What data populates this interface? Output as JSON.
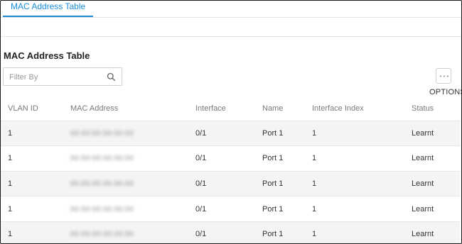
{
  "tabs": [
    {
      "label": "MAC Address Table",
      "active": true
    }
  ],
  "section": {
    "title": "MAC Address Table"
  },
  "filter": {
    "placeholder": "Filter By",
    "value": ""
  },
  "options": {
    "label": "OPTIONS"
  },
  "table": {
    "columns": [
      "VLAN ID",
      "MAC Address",
      "Interface",
      "Name",
      "Interface Index",
      "Status"
    ],
    "rows": [
      {
        "vlan": "1",
        "mac": "00:00:00:00:00:00",
        "interface": "0/1",
        "name": "Port 1",
        "index": "1",
        "status": "Learnt"
      },
      {
        "vlan": "1",
        "mac": "00:00:00:00:00:00",
        "interface": "0/1",
        "name": "Port 1",
        "index": "1",
        "status": "Learnt"
      },
      {
        "vlan": "1",
        "mac": "00:00:00:00:00:00",
        "interface": "0/1",
        "name": "Port 1",
        "index": "1",
        "status": "Learnt"
      },
      {
        "vlan": "1",
        "mac": "00:00:00:00:00:00",
        "interface": "0/1",
        "name": "Port 1",
        "index": "1",
        "status": "Learnt"
      },
      {
        "vlan": "1",
        "mac": "00:00:00:00:00:00",
        "interface": "0/1",
        "name": "Port 1",
        "index": "1",
        "status": "Learnt"
      }
    ]
  },
  "colors": {
    "accent": "#1a8cd8",
    "row_alt": "#f4f4f4",
    "header_text": "#7a7a7a"
  },
  "icons": {
    "search": "search-icon",
    "options": "more-dots-icon"
  }
}
